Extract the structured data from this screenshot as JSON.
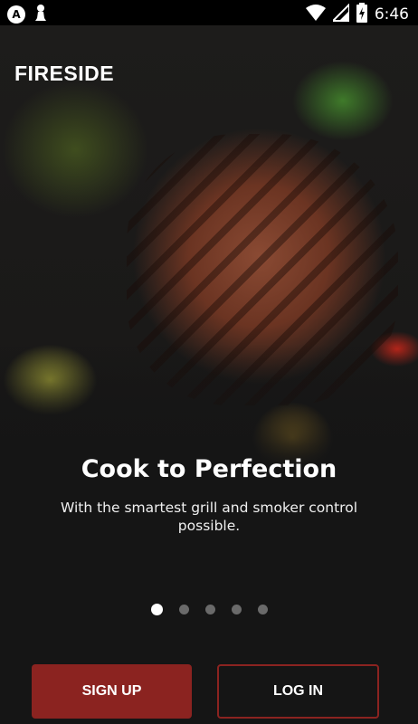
{
  "status_bar": {
    "time": "6:46",
    "left_icons": [
      "circle-a-icon",
      "chess-pawn-icon"
    ],
    "right_icons": [
      "wifi-icon",
      "signal-icon",
      "battery-charging-icon"
    ]
  },
  "brand": {
    "name": "FIRESIDE"
  },
  "hero": {
    "image": "grilled-steak-with-vegetables"
  },
  "onboarding": {
    "title": "Cook to Perfection",
    "subtitle": "With the smartest grill and smoker control possible.",
    "page_indicator": {
      "total": 5,
      "active_index": 0
    }
  },
  "actions": {
    "signup_label": "SIGN UP",
    "login_label": "LOG IN"
  },
  "colors": {
    "accent": "#8b2320",
    "background": "#151515"
  }
}
